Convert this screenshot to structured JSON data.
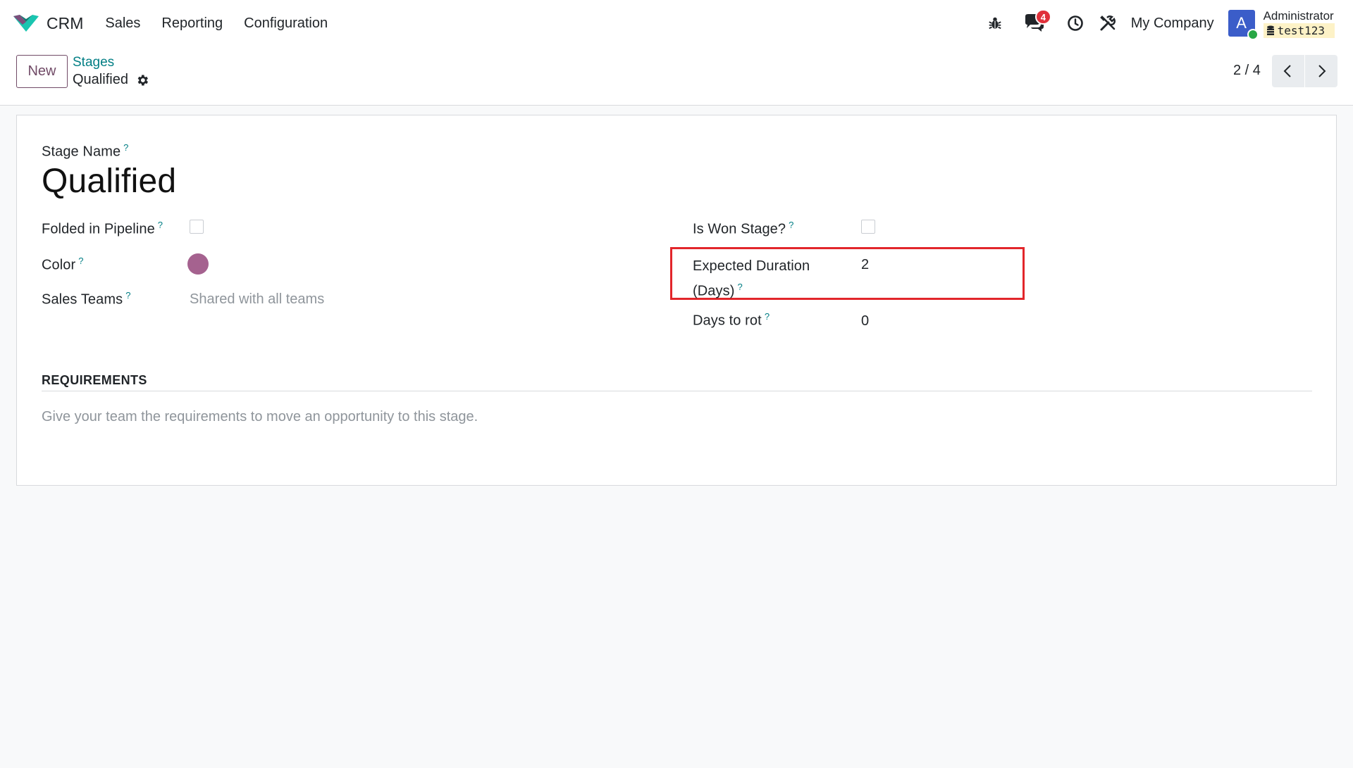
{
  "navbar": {
    "app_name": "CRM",
    "menu": [
      "Sales",
      "Reporting",
      "Configuration"
    ],
    "chat_count": "4",
    "company": "My Company",
    "avatar_letter": "A",
    "user_name": "Administrator",
    "database": "test123"
  },
  "control_panel": {
    "new_label": "New",
    "breadcrumb_parent": "Stages",
    "breadcrumb_current": "Qualified",
    "pager": "2 / 4"
  },
  "form": {
    "stage_name_label": "Stage Name",
    "stage_name": "Qualified",
    "folded_label": "Folded in Pipeline",
    "folded_checked": false,
    "color_label": "Color",
    "color_value": "#a5628f",
    "sales_teams_label": "Sales Teams",
    "sales_teams_placeholder": "Shared with all teams",
    "is_won_label": "Is Won Stage?",
    "is_won_checked": false,
    "expected_duration_label_line1": "Expected Duration",
    "expected_duration_label_line2": "(Days)",
    "expected_duration": "2",
    "days_to_rot_label": "Days to rot",
    "days_to_rot": "0",
    "help_mark": "?",
    "requirements_title": "REQUIREMENTS",
    "requirements_placeholder": "Give your team the requirements to move an opportunity to this stage."
  },
  "colors": {
    "accent": "#714b67",
    "link": "#017e84",
    "highlight": "#e2262b",
    "badge": "#e0313b"
  }
}
